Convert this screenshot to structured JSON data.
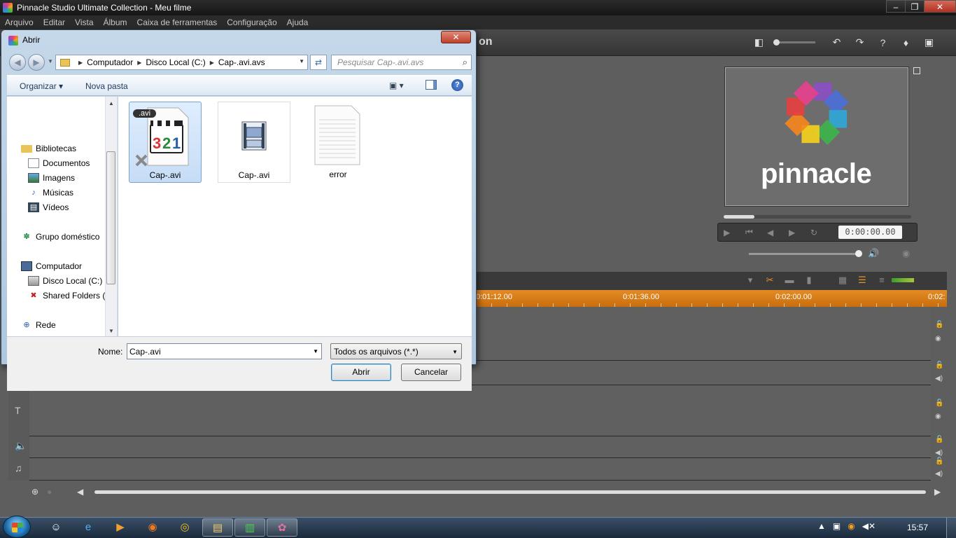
{
  "app": {
    "title": "Pinnacle Studio Ultimate Collection - Meu filme",
    "menu": [
      "Arquivo",
      "Editar",
      "Vista",
      "Álbum",
      "Caixa de ferramentas",
      "Configuração",
      "Ajuda"
    ],
    "tab_title_partial": "on",
    "window_controls": {
      "minimize": "‒",
      "restore": "❐",
      "close": "✕"
    }
  },
  "preview": {
    "logo_text": "pinnacle",
    "timecode": "0:00:00.00"
  },
  "timeline": {
    "ruler_labels": [
      "0:01:12.00",
      "0:01:36.00",
      "0:02:00.00",
      "0:02:"
    ]
  },
  "dialog": {
    "title": "Abrir",
    "close_glyph": "✕",
    "address": {
      "crumbs": [
        "Computador",
        "Disco Local (C:)",
        "Cap-.avi.avs"
      ]
    },
    "search": {
      "placeholder": "Pesquisar Cap-.avi.avs"
    },
    "commands": {
      "organize": "Organizar",
      "new_folder": "Nova pasta",
      "help": "?"
    },
    "nav": {
      "libraries": "Bibliotecas",
      "documents": "Documentos",
      "images": "Imagens",
      "music": "Músicas",
      "videos": "Vídeos",
      "homegroup": "Grupo doméstico",
      "computer": "Computador",
      "local_disk": "Disco Local (C:)",
      "shared_folders": "Shared Folders (\\",
      "network": "Rede"
    },
    "files": [
      {
        "name": "Cap-.avi",
        "badge": ".avi",
        "icon": "media-player-classic-icon",
        "selected": true
      },
      {
        "name": "Cap-.avi",
        "icon": "video-file-icon",
        "selected": false
      },
      {
        "name": "error",
        "icon": "text-file-icon",
        "selected": false
      }
    ],
    "filename_label": "Nome:",
    "filename_value": "Cap-.avi",
    "filetype_value": "Todos os arquivos (*.*)",
    "open_button": "Abrir",
    "cancel_button": "Cancelar"
  },
  "taskbar": {
    "clock": "15:57"
  },
  "colors": {
    "dialog_frame": "#aec7df",
    "ruler_orange": "#d97a16",
    "pinnacle_bg": "#5e5e5e"
  }
}
